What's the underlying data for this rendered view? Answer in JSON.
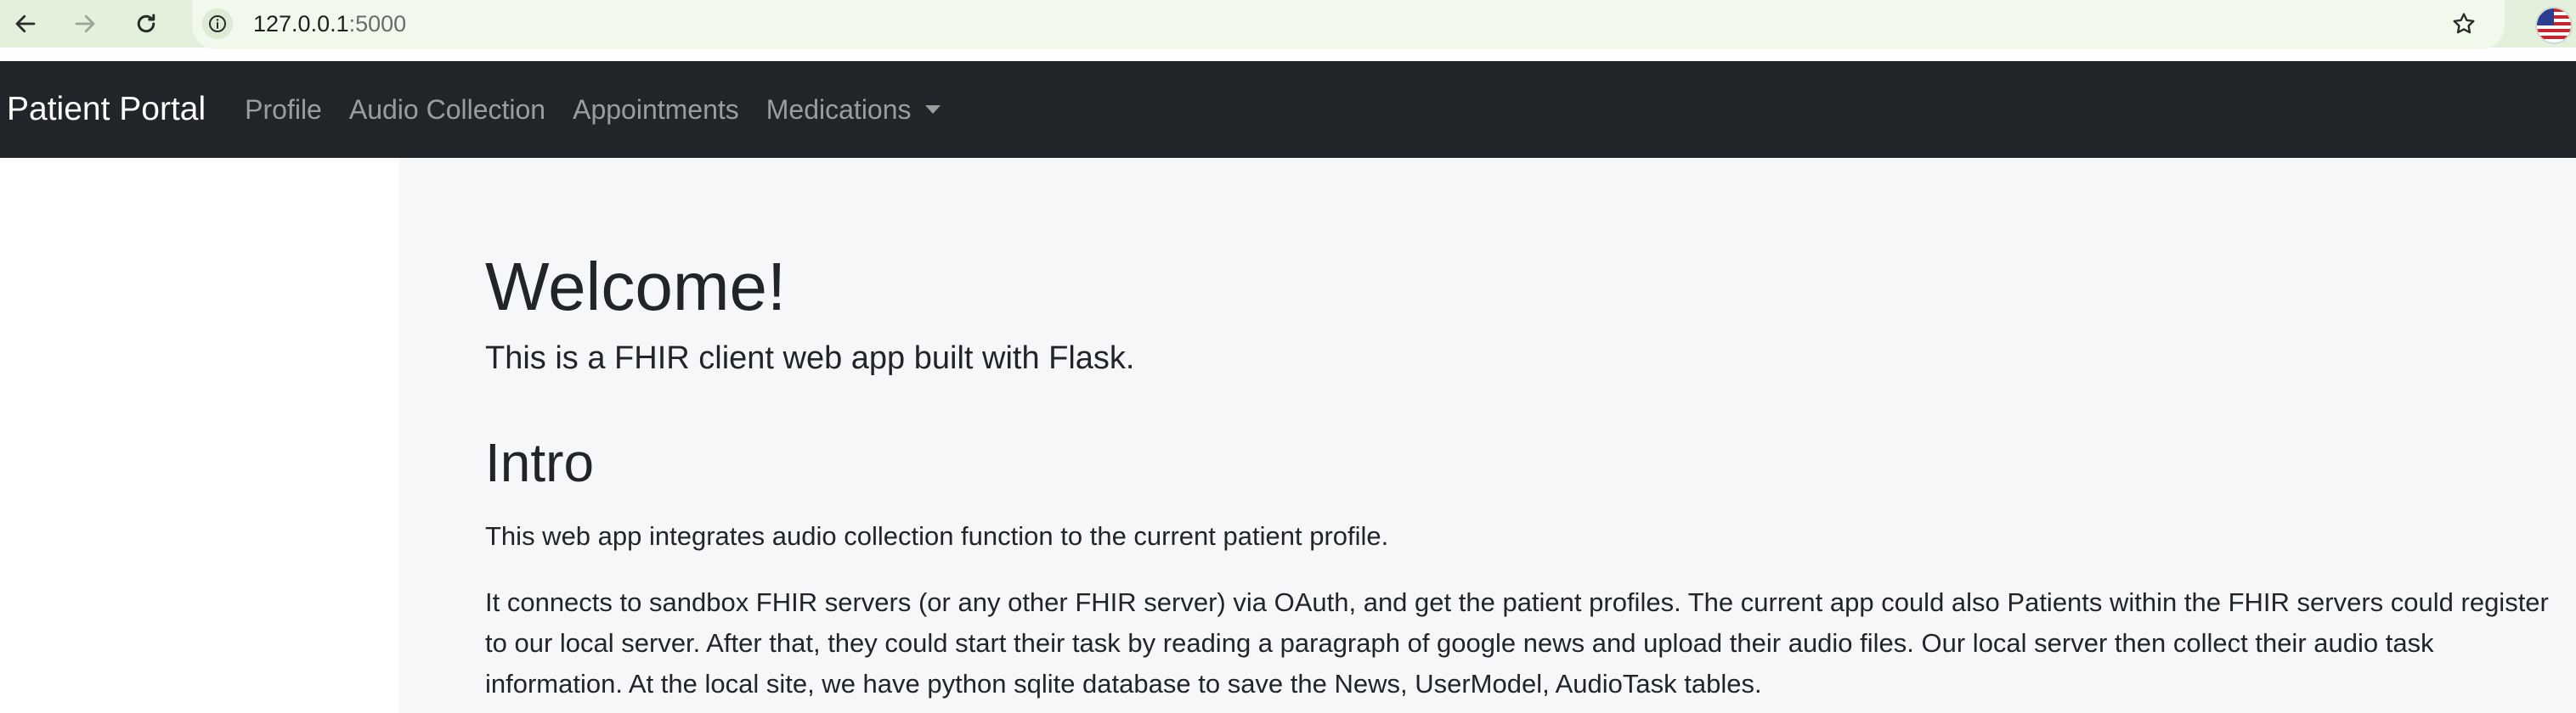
{
  "browser": {
    "url_host": "127.0.0.1",
    "url_port": ":5000",
    "icons": [
      "back-arrow-icon",
      "forward-arrow-icon",
      "reload-icon",
      "info-icon",
      "star-icon",
      "profile-flag-icon"
    ]
  },
  "navbar": {
    "brand": "Patient Portal",
    "links": [
      "Profile",
      "Audio Collection",
      "Appointments",
      "Medications"
    ],
    "bg_color": "#212529"
  },
  "main": {
    "title": "Welcome!",
    "subtitle": "This is a FHIR client web app built with Flask.",
    "intro_heading": "Intro",
    "paragraph1": "This web app integrates audio collection function to the current patient profile.",
    "paragraph2": "It connects to sandbox FHIR servers (or any other FHIR server) via OAuth, and get the patient profiles. The current app could also Patients within the FHIR servers could register to our local server. After that, they could start their task by reading a paragraph of google news and upload their audio files. Our local server then collect their audio task information. At the local site, we have python sqlite database to save the News, UserModel, AudioTask tables."
  }
}
